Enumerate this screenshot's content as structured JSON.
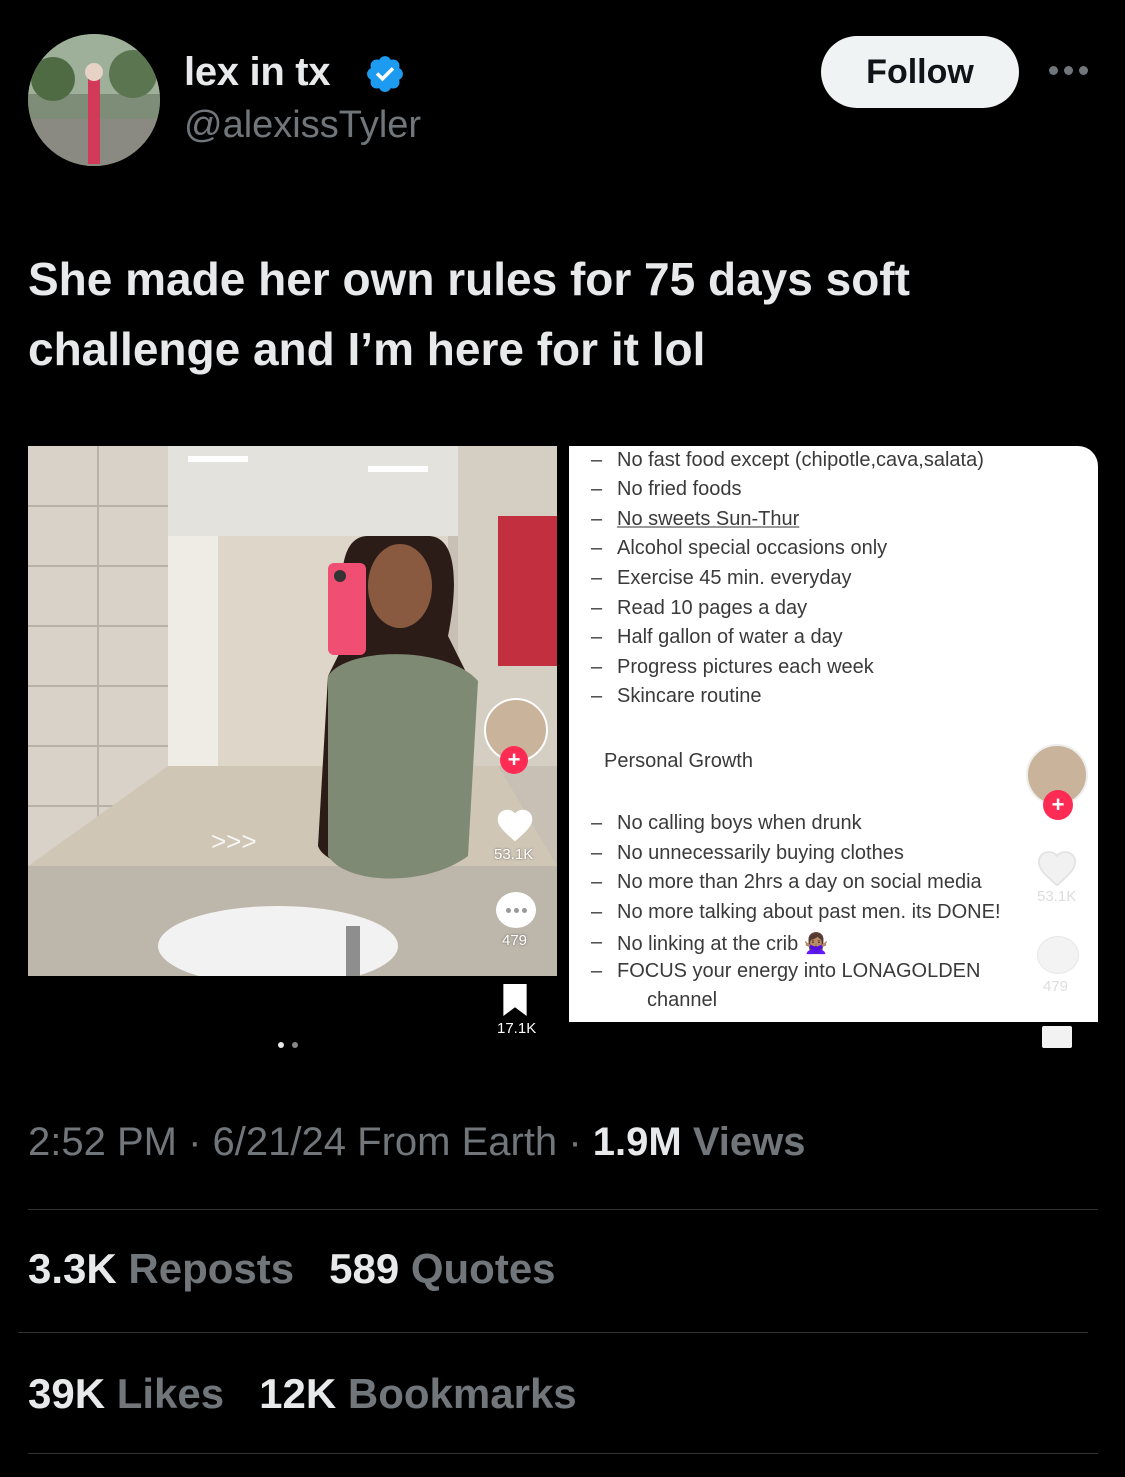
{
  "author": {
    "display_name": "lex in tx",
    "handle": "@alexissTyler",
    "verified": true,
    "follow_label": "Follow"
  },
  "tweet": {
    "text_line1": "She made her own rules for 75 days soft",
    "text_line2": "challenge and I’m here for it lol"
  },
  "media_left": {
    "arrows": ">>>",
    "likes": "53.1K",
    "comments": "479",
    "bookmarks": "17.1K"
  },
  "media_right": {
    "rules_top": [
      "No fast food except (chipotle,cava,salata)",
      "No fried foods",
      "No sweets Sun-Thur",
      "Alcohol special occasions only",
      "Exercise 45 min. everyday",
      "Read 10 pages a day",
      "Half gallon of water a day",
      "Progress pictures each week",
      "Skincare routine"
    ],
    "section_title": "Personal Growth",
    "rules_bottom": [
      "No calling boys when drunk",
      "No unnecessarily buying clothes",
      "No more than 2hrs a day on social media",
      "No more talking about past men. its DONE!",
      "No linking at the crib 🙅🏽‍♀️",
      "FOCUS your energy into LONAGOLDEN",
      "channel"
    ],
    "likes": "53.1K",
    "comments": "479"
  },
  "meta": {
    "time": "2:52 PM",
    "sep1": "·",
    "date": "6/21/24",
    "source": "From Earth",
    "sep2": "·",
    "views_count": "1.9M",
    "views_label": "Views"
  },
  "stats": {
    "reposts_count": "3.3K",
    "reposts_label": "Reposts",
    "quotes_count": "589",
    "quotes_label": "Quotes",
    "likes_count": "39K",
    "likes_label": "Likes",
    "bookmarks_count": "12K",
    "bookmarks_label": "Bookmarks"
  },
  "colors": {
    "background": "#000000",
    "text_primary": "#e7e9ea",
    "text_secondary": "#71767b",
    "verified_blue": "#1d9bf0",
    "follow_bg": "#eff3f4",
    "tiktok_red": "#fe2c55"
  }
}
